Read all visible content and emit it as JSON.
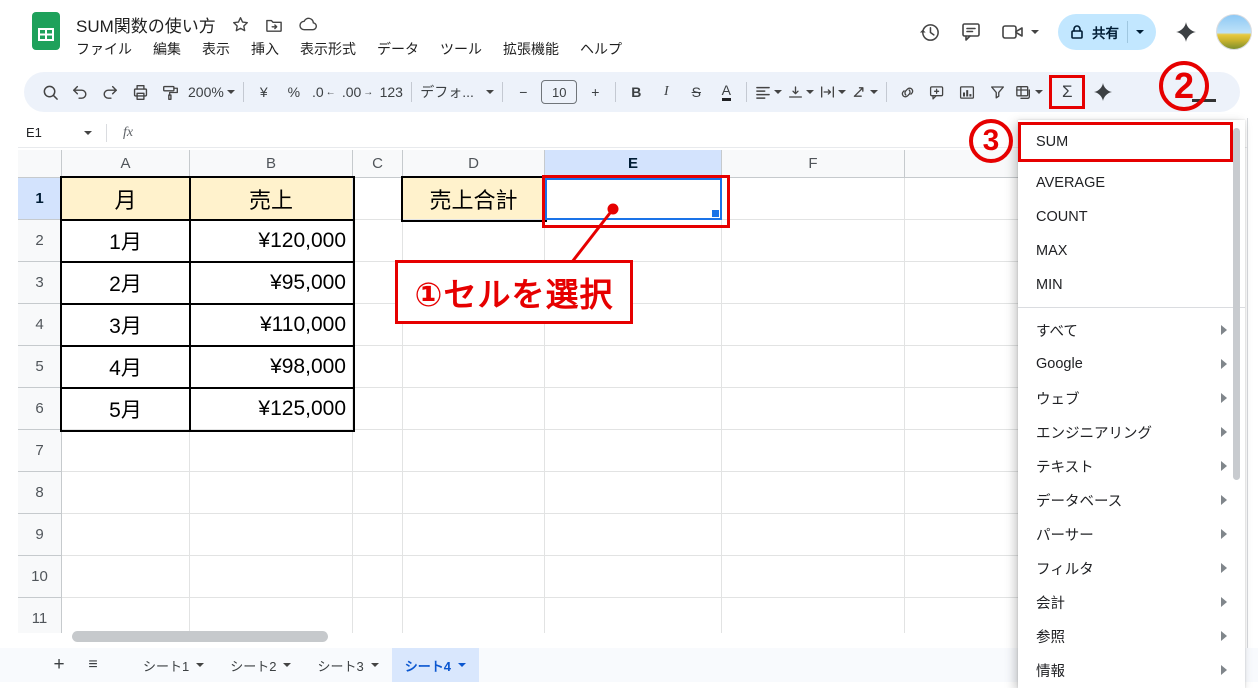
{
  "titlebar": {
    "title": "SUM関数の使い方",
    "menus": [
      "ファイル",
      "編集",
      "表示",
      "挿入",
      "表示形式",
      "データ",
      "ツール",
      "拡張機能",
      "ヘルプ"
    ],
    "share": "共有"
  },
  "toolbar": {
    "zoom": "200%",
    "currency": "¥",
    "percent": "%",
    "decimal_decrease": ".0",
    "decimal_decrease_arrow": "←",
    "decimal_increase": ".00",
    "decimal_increase_arrow": "→",
    "format_123": "123",
    "font_name": "デフォ...",
    "decrease_size": "−",
    "font_size": "10",
    "increase_size": "+",
    "bold": "B",
    "italic": "I",
    "strikethrough": "S",
    "text_color": "A",
    "functions": "Σ"
  },
  "formula_bar": {
    "name_box": "E1",
    "fx": "fx"
  },
  "grid": {
    "column_labels": [
      "A",
      "B",
      "C",
      "D",
      "E",
      "F",
      ""
    ],
    "row_labels": [
      "1",
      "2",
      "3",
      "4",
      "5",
      "6",
      "7",
      "8",
      "9",
      "10",
      "11"
    ],
    "selected_cell": "E1",
    "selected_column": "E",
    "selected_row": "1",
    "cells": {
      "A1": "月",
      "B1": "売上",
      "D1": "売上合計",
      "A2": "1月",
      "B2": "¥120,000",
      "A3": "2月",
      "B3": "¥95,000",
      "A4": "3月",
      "B4": "¥110,000",
      "A5": "4月",
      "B5": "¥98,000",
      "A6": "5月",
      "B6": "¥125,000"
    }
  },
  "annotations": {
    "step1": "①セルを選択",
    "step2": "2",
    "step3": "3"
  },
  "function_menu": {
    "primary": [
      "SUM",
      "AVERAGE",
      "COUNT",
      "MAX",
      "MIN"
    ],
    "highlighted": "SUM",
    "categories": [
      "すべて",
      "Google",
      "ウェブ",
      "エンジニアリング",
      "テキスト",
      "データベース",
      "パーサー",
      "フィルタ",
      "会計",
      "参照",
      "情報"
    ]
  },
  "sheet_tabs": {
    "add": "+",
    "all": "≡",
    "tabs": [
      "シート1",
      "シート2",
      "シート3",
      "シート4"
    ],
    "active": "シート4"
  }
}
